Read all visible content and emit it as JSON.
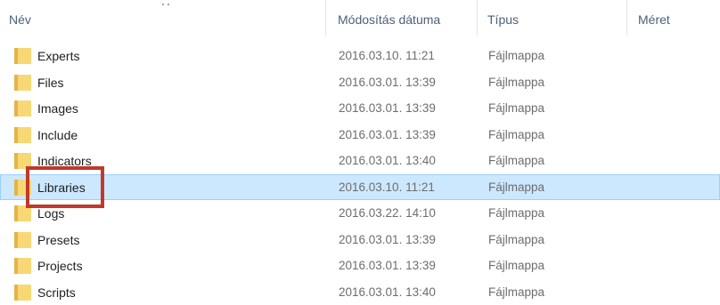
{
  "columns": {
    "name": "Név",
    "modified": "Módosítás dátuma",
    "type": "Típus",
    "size": "Méret"
  },
  "colors": {
    "header_text": "#4c607a",
    "folder_fill": "#f8d775",
    "selection_bg": "#cce8ff",
    "selection_border": "#99d1ff",
    "highlight_border": "#c0392b"
  },
  "rows": [
    {
      "name": "Experts",
      "date": "2016.03.10. 11:21",
      "type": "Fájlmappa",
      "icon": "folder-icon"
    },
    {
      "name": "Files",
      "date": "2016.03.01. 13:39",
      "type": "Fájlmappa",
      "icon": "folder-icon"
    },
    {
      "name": "Images",
      "date": "2016.03.01. 13:39",
      "type": "Fájlmappa",
      "icon": "folder-icon"
    },
    {
      "name": "Include",
      "date": "2016.03.01. 13:39",
      "type": "Fájlmappa",
      "icon": "folder-icon"
    },
    {
      "name": "Indicators",
      "date": "2016.03.01. 13:40",
      "type": "Fájlmappa",
      "icon": "folder-icon"
    },
    {
      "name": "Libraries",
      "date": "2016.03.10. 11:21",
      "type": "Fájlmappa",
      "icon": "folder-icon",
      "selected": true
    },
    {
      "name": "Logs",
      "date": "2016.03.22. 14:10",
      "type": "Fájlmappa",
      "icon": "folder-icon"
    },
    {
      "name": "Presets",
      "date": "2016.03.01. 13:39",
      "type": "Fájlmappa",
      "icon": "folder-icon"
    },
    {
      "name": "Projects",
      "date": "2016.03.01. 13:39",
      "type": "Fájlmappa",
      "icon": "folder-icon"
    },
    {
      "name": "Scripts",
      "date": "2016.03.01. 13:40",
      "type": "Fájlmappa",
      "icon": "folder-icon"
    }
  ]
}
